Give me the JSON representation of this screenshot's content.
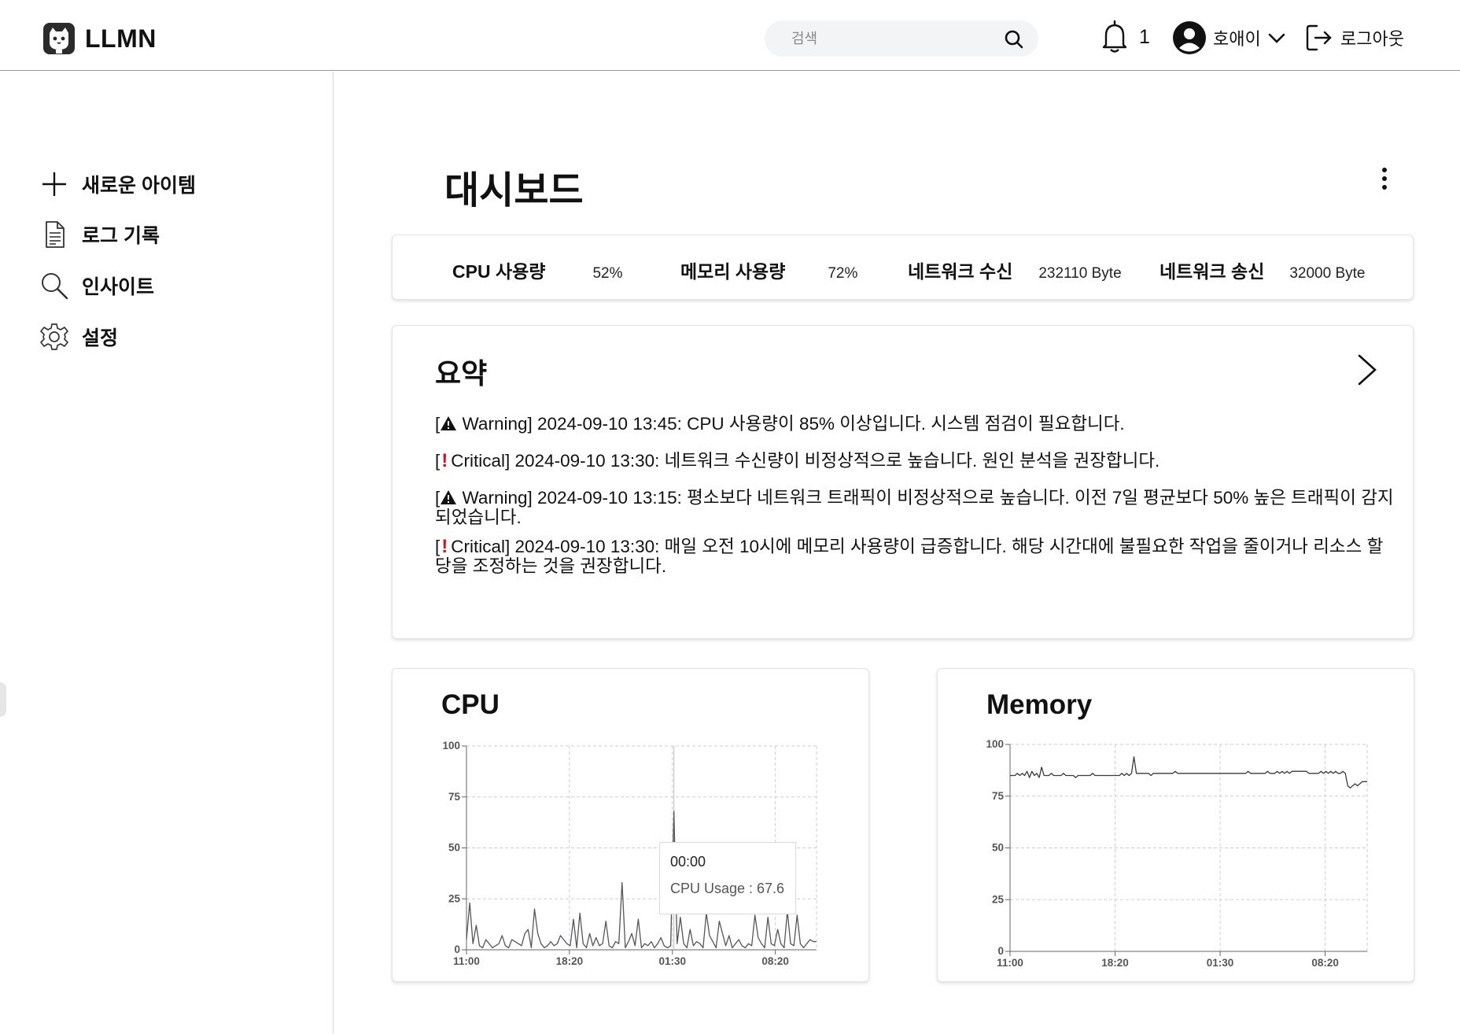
{
  "header": {
    "logo_text": "LLMN",
    "search_placeholder": "검색",
    "notification_count": "1",
    "user_name": "호애이",
    "logout_label": "로그아웃"
  },
  "sidebar": {
    "items": [
      {
        "label": "새로운 아이템",
        "icon": "plus-icon"
      },
      {
        "label": "로그 기록",
        "icon": "document-icon"
      },
      {
        "label": "인사이트",
        "icon": "search-icon"
      },
      {
        "label": "설정",
        "icon": "gear-icon"
      }
    ]
  },
  "page": {
    "title": "대시보드"
  },
  "metrics": [
    {
      "label": "CPU 사용량",
      "value": "52%"
    },
    {
      "label": "메모리 사용량",
      "value": "72%"
    },
    {
      "label": "네트워크 수신",
      "value": "232110 Byte"
    },
    {
      "label": "네트워크 송신",
      "value": "32000 Byte"
    }
  ],
  "summary": {
    "title": "요약",
    "alerts": [
      {
        "severity": "Warning",
        "text": "Warning] 2024-09-10 13:45: CPU 사용량이 85% 이상입니다. 시스템 점검이 필요합니다."
      },
      {
        "severity": "Critical",
        "text": "Critical] 2024-09-10 13:30: 네트워크 수신량이 비정상적으로 높습니다. 원인 분석을 권장합니다."
      },
      {
        "severity": "Warning",
        "text": "Warning] 2024-09-10 13:15: 평소보다 네트워크 트래픽이 비정상적으로 높습니다. 이전 7일 평균보다 50% 높은 트래픽이 감지되었습니다."
      },
      {
        "severity": "Critical",
        "text": "Critical] 2024-09-10 13:30: 매일 오전 10시에 메모리 사용량이 급증합니다. 해당 시간대에 불필요한 작업을 줄이거나 리소스 할당을 조정하는 것을 권장합니다."
      }
    ]
  },
  "chart_data": [
    {
      "type": "line",
      "title": "CPU",
      "x_ticks": [
        "11:00",
        "18:20",
        "01:30",
        "08:20"
      ],
      "y_ticks": [
        0,
        25,
        50,
        75,
        100
      ],
      "ylim": [
        0,
        100
      ],
      "grid": true,
      "values": [
        5,
        23,
        3,
        12,
        2,
        1,
        5,
        3,
        1,
        2,
        3,
        7,
        2,
        1,
        5,
        4,
        3,
        2,
        8,
        10,
        1,
        20,
        8,
        3,
        1,
        2,
        4,
        2,
        3,
        7,
        5,
        3,
        2,
        15,
        1,
        18,
        3,
        1,
        8,
        2,
        6,
        2,
        3,
        14,
        2,
        1,
        4,
        3,
        33,
        1,
        4,
        8,
        2,
        15,
        1,
        3,
        2,
        4,
        1,
        3,
        6,
        2,
        1,
        2,
        68,
        3,
        16,
        3,
        1,
        10,
        2,
        4,
        3,
        1,
        18,
        7,
        4,
        1,
        14,
        8,
        2,
        7,
        1,
        3,
        5,
        2,
        1,
        3,
        2,
        17,
        6,
        3,
        1,
        16,
        3,
        2,
        10,
        3,
        1,
        19,
        3,
        2,
        17,
        3,
        1,
        3,
        5,
        4,
        4
      ],
      "line_color": "#55555c",
      "tooltip": {
        "time": "00:00",
        "label": "CPU Usage : 67.6"
      }
    },
    {
      "type": "line",
      "title": "Memory",
      "x_ticks": [
        "11:00",
        "18:20",
        "01:30",
        "08:20"
      ],
      "y_ticks": [
        0,
        25,
        50,
        75,
        100
      ],
      "ylim": [
        0,
        100
      ],
      "grid": true,
      "values": [
        85,
        85,
        85,
        86,
        85,
        86,
        85,
        87,
        84,
        87,
        85,
        86,
        84,
        89,
        85,
        85,
        85,
        86,
        85,
        85,
        85,
        85,
        86,
        85,
        85,
        85,
        85,
        84,
        85,
        85,
        85,
        85,
        85,
        85,
        86,
        85,
        85,
        85,
        85,
        85,
        85,
        85,
        85,
        85,
        85,
        85,
        86,
        85,
        86,
        85,
        86,
        94,
        86,
        86,
        86,
        86,
        86,
        86,
        85,
        86,
        86,
        86,
        86,
        86,
        86,
        86,
        86,
        86,
        87,
        86,
        86,
        86,
        86,
        86,
        86,
        86,
        86,
        86,
        86,
        86,
        86,
        86,
        86,
        86,
        86,
        86,
        86,
        86,
        86,
        86,
        86,
        86,
        86,
        86,
        86,
        86,
        86,
        86,
        87,
        86,
        86,
        86,
        86,
        86,
        86,
        86,
        87,
        86,
        86,
        86,
        87,
        86,
        87,
        86,
        87,
        86,
        87,
        87,
        87,
        87,
        87,
        87,
        87,
        86,
        86,
        86,
        86,
        86,
        87,
        86,
        87,
        86,
        87,
        86,
        87,
        86,
        86,
        87,
        86,
        80,
        79,
        80,
        81,
        80,
        81,
        82,
        82,
        82
      ],
      "line_color": "#3a3a3a"
    }
  ]
}
